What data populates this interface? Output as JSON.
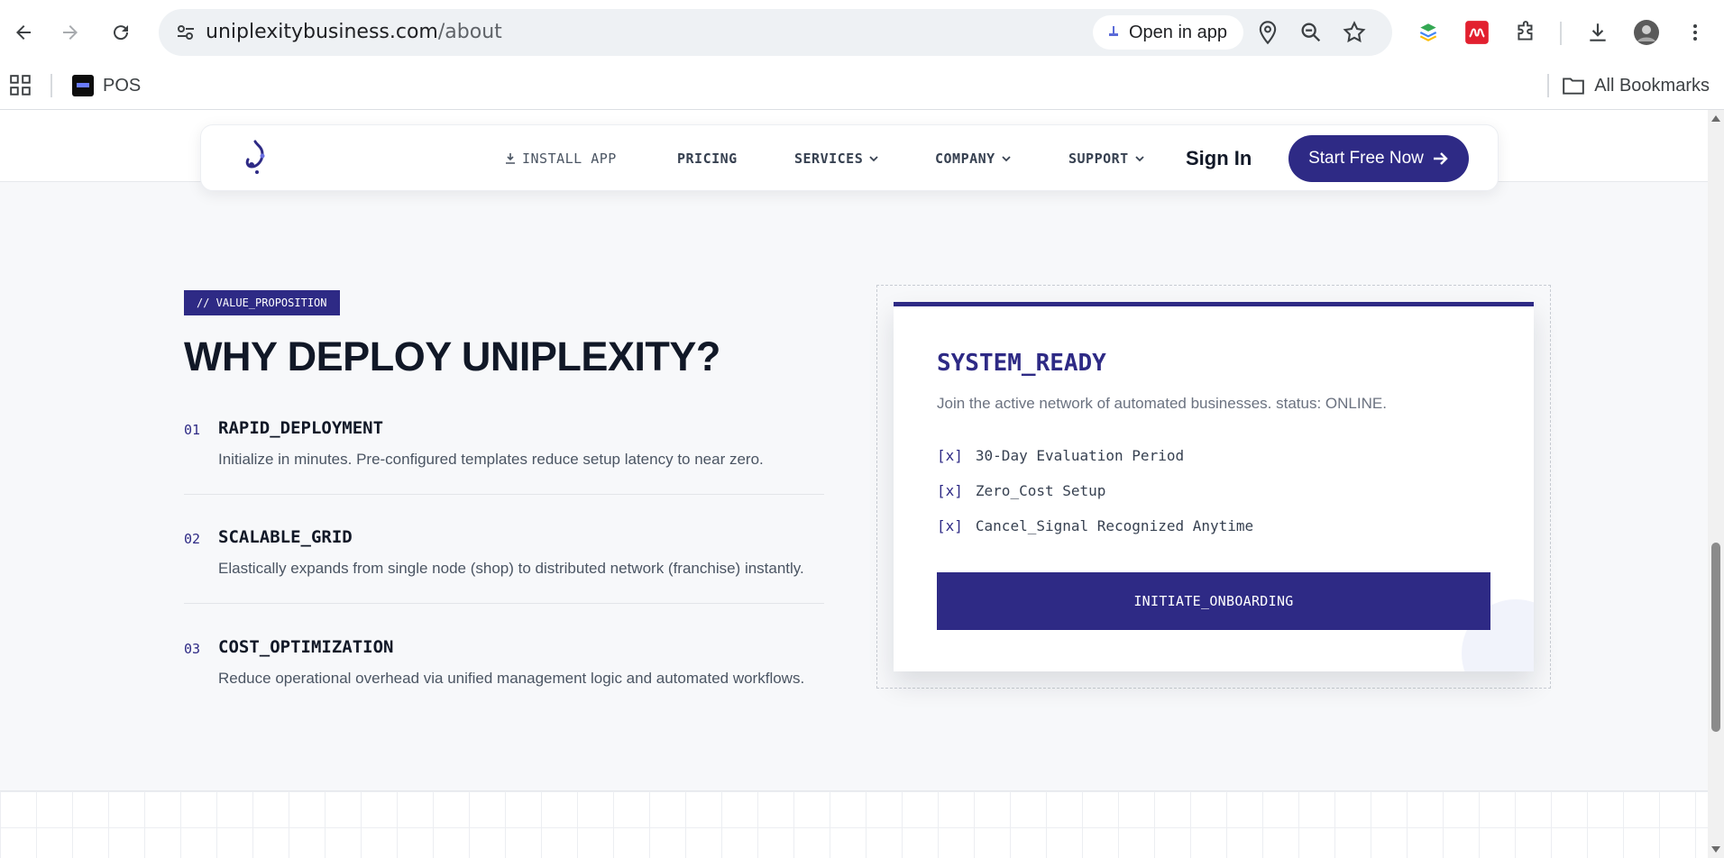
{
  "browser": {
    "url_domain": "uniplexitybusiness.com",
    "url_path": "/about",
    "open_in_app_label": "Open in app",
    "bookmarks": {
      "pos_label": "POS",
      "all_bookmarks_label": "All Bookmarks"
    }
  },
  "site_nav": {
    "install_label": "INSTALL APP",
    "pricing_label": "PRICING",
    "services_label": "SERVICES",
    "company_label": "COMPANY",
    "support_label": "SUPPORT",
    "signin_label": "Sign In",
    "cta_label": "Start Free Now"
  },
  "section": {
    "tag": "// VALUE_PROPOSITION",
    "headline": "WHY DEPLOY UNIPLEXITY?",
    "features": [
      {
        "num": "01",
        "title": "RAPID_DEPLOYMENT",
        "desc": "Initialize in minutes. Pre-configured templates reduce setup latency to near zero."
      },
      {
        "num": "02",
        "title": "SCALABLE_GRID",
        "desc": "Elastically expands from single node (shop) to distributed network (franchise) instantly."
      },
      {
        "num": "03",
        "title": "COST_OPTIMIZATION",
        "desc": "Reduce operational overhead via unified management logic and automated workflows."
      }
    ]
  },
  "card": {
    "title": "SYSTEM_READY",
    "subtitle": "Join the active network of automated businesses. status: ONLINE.",
    "checkbox_mark": "[x]",
    "checks": [
      "30-Day Evaluation Period",
      "Zero_Cost Setup",
      "Cancel_Signal Recognized Anytime"
    ],
    "button_label": "INITIATE_ONBOARDING"
  },
  "colors": {
    "brand": "#2e2a85",
    "page_bg": "#f7f8fa"
  }
}
